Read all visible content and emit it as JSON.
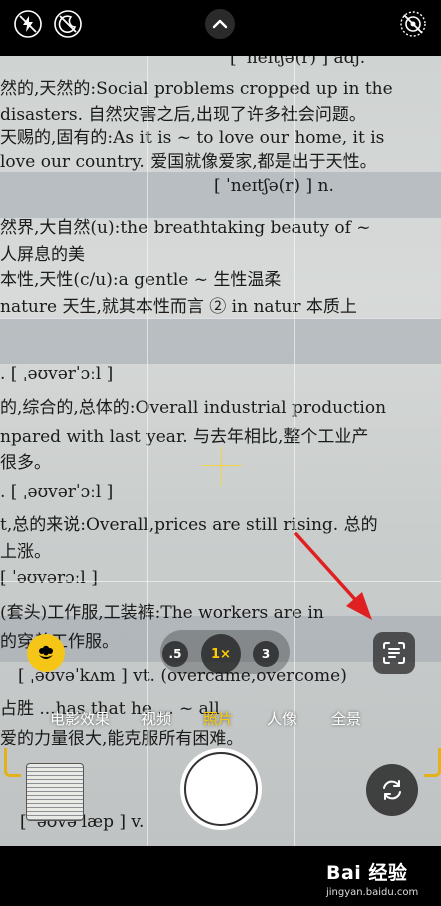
{
  "top_bar": {
    "icons": [
      "flash-off-icon",
      "live-photo-off-icon",
      "chevron-up-icon",
      "live-off-icon"
    ]
  },
  "viewfinder": {
    "dictionary_lines": [
      "[ ˈneɪtʃə(r) ] adj.",
      "然的,天然的:Social problems cropped up in the",
      "disasters. 自然灾害之后,出现了许多社会问题。",
      "天赐的,固有的:As it is ~ to love our home, it is",
      "love our country. 爱国就像爱家,都是出于天性。",
      "[ ˈneɪtʃə(r) ] n.",
      "然界,大自然(u):the breathtaking beauty of ~",
      "人屏息的美",
      "本性,天性(c/u):a gentle ~ 生性温柔",
      "nature 天生,就其本性而言 ② in natur 本质上",
      ". [ ˌəʊvərˈɔːl ]",
      "的,综合的,总体的:Overall industrial production",
      "npared with last year. 与去年相比,整个工业产",
      "很多。",
      ". [ ˌəʊvərˈɔːl ]",
      "t,总的来说:Overall,prices are still rising. 总的",
      "上涨。",
      "[ ˈəʊvərɔːl ]",
      "(套头)工作服,工装裤:The workers are in",
      "的穿着工作服。",
      "[ ˌəʊvəˈkʌm ] vt. (overcame,overcome)",
      "占胜 ...has that he ... ~ all",
      "爱的力量很大,能克服所有困难。",
      "[ ˈəʊvəˈlæp ] v."
    ]
  },
  "controls": {
    "macro_icon": "flower-macro-icon",
    "live_text_icon": "live-text-scan-icon",
    "zoom": {
      "options": [
        ".5",
        "1×",
        "3"
      ],
      "selected": "1×"
    },
    "modes": [
      "电影效果",
      "视频",
      "照片",
      "人像",
      "全景"
    ],
    "active_mode": "照片",
    "shutter_icon": "shutter-button",
    "flip_icon": "camera-flip-icon",
    "thumbnail_icon": "last-photo-thumbnail",
    "accent": "#ffcc00",
    "annotation_arrow_color": "#e02020"
  },
  "watermark": {
    "logo": "Bai 经验",
    "url": "jingyan.baidu.com"
  }
}
